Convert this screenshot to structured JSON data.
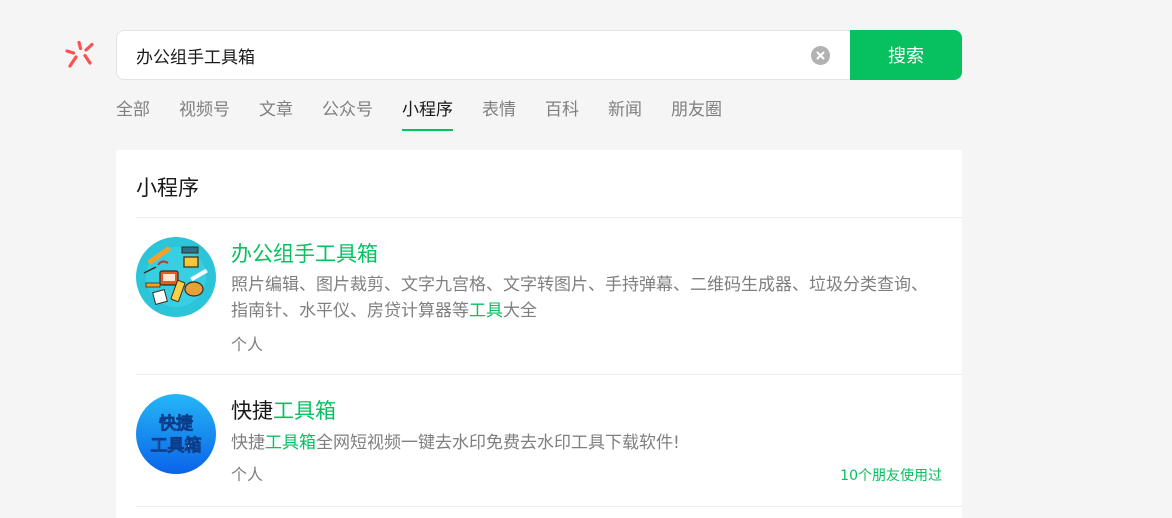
{
  "search": {
    "query": "办公组手工具箱",
    "button_label": "搜索"
  },
  "tabs": [
    {
      "label": "全部",
      "active": false
    },
    {
      "label": "视频号",
      "active": false
    },
    {
      "label": "文章",
      "active": false
    },
    {
      "label": "公众号",
      "active": false
    },
    {
      "label": "小程序",
      "active": true
    },
    {
      "label": "表情",
      "active": false
    },
    {
      "label": "百科",
      "active": false
    },
    {
      "label": "新闻",
      "active": false
    },
    {
      "label": "朋友圈",
      "active": false
    }
  ],
  "section": {
    "title": "小程序",
    "items": [
      {
        "title_pre": "",
        "title_hl": "办公组手工具箱",
        "desc_pre": "照片编辑、图片裁剪、文字九宫格、文字转图片、手持弹幕、二维码生成器、垃圾分类查询、指南针、水平仪、房贷计算器等",
        "desc_hl": "工具",
        "desc_post": "大全",
        "type": "个人",
        "friends": ""
      },
      {
        "title_pre": "快捷",
        "title_hl": "工具箱",
        "desc_pre": "快捷",
        "desc_hl": "工具箱",
        "desc_post": "全网短视频一键去水印免费去水印工具下载软件!",
        "type": "个人",
        "friends": "10个朋友使用过",
        "icon_text_1": "快捷",
        "icon_text_2": "工具箱"
      }
    ]
  },
  "colors": {
    "accent": "#07c160",
    "logo": "#fa5151"
  }
}
